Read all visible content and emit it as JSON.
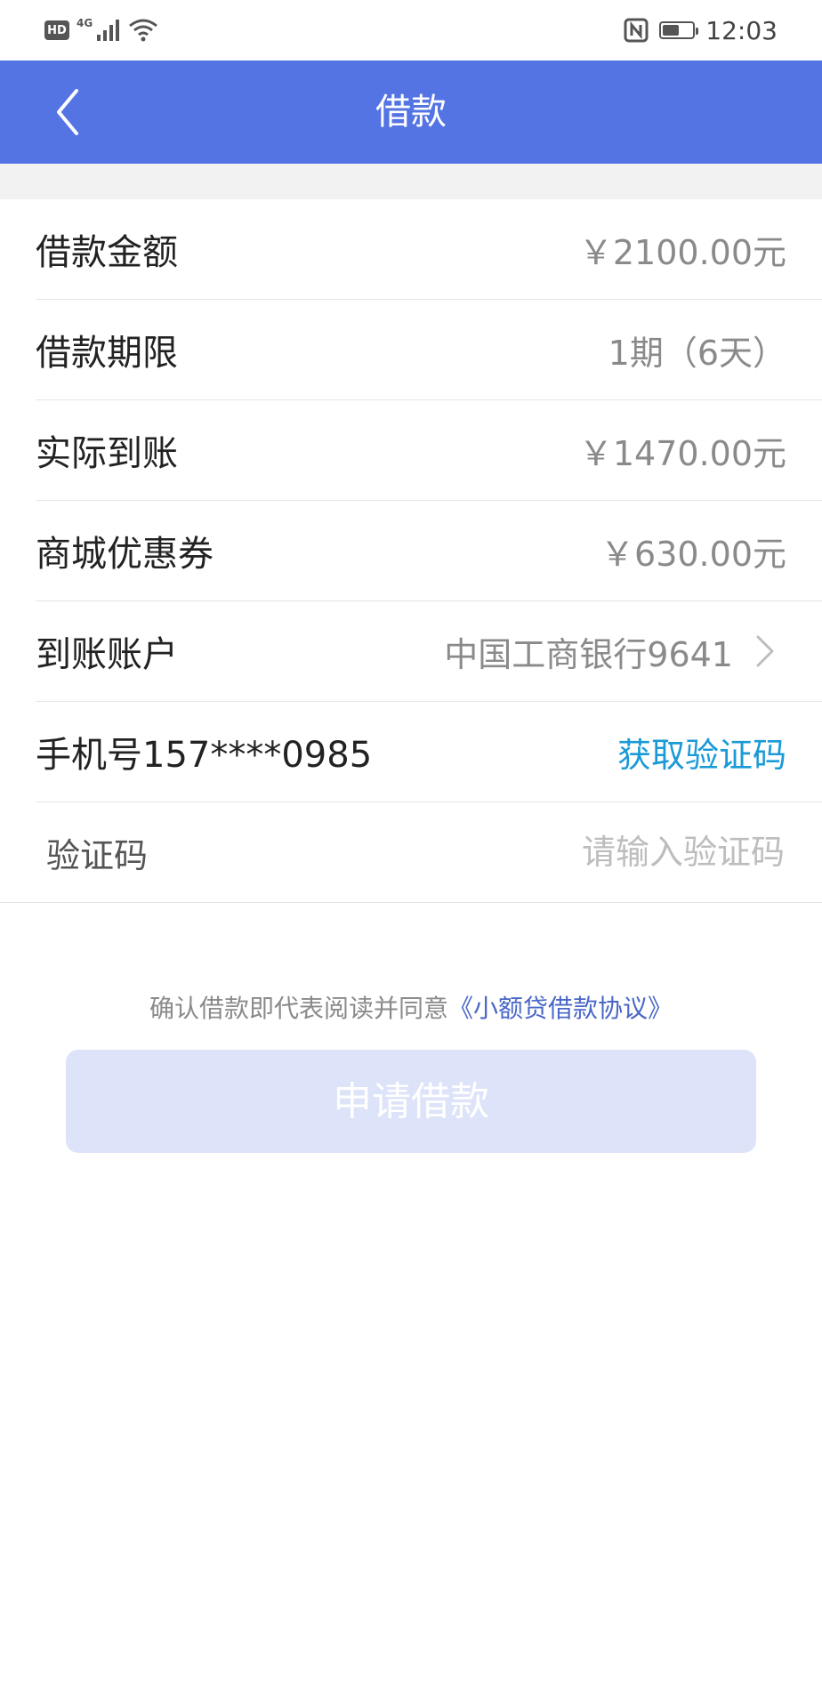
{
  "status_bar": {
    "hd": "HD",
    "network": "4G",
    "time": "12:03",
    "battery_level": 0.55,
    "icons": [
      "signal-icon",
      "wifi-icon",
      "nfc-icon",
      "battery-icon"
    ]
  },
  "nav": {
    "title": "借款",
    "back_icon": "chevron-left-icon",
    "color": "#5474e3"
  },
  "form": {
    "amount": {
      "label": "借款金额",
      "value": "￥2100.00元"
    },
    "term": {
      "label": "借款期限",
      "value": "1期（6天）"
    },
    "received": {
      "label": "实际到账",
      "value": "￥1470.00元"
    },
    "coupon": {
      "label": "商城优惠券",
      "value": "￥630.00元"
    },
    "account": {
      "label": "到账账户",
      "value": "中国工商银行9641"
    },
    "phone": {
      "label": "手机号157****0985",
      "action": "获取验证码"
    },
    "code": {
      "label": "验证码",
      "placeholder": "请输入验证码"
    }
  },
  "agreement": {
    "prefix": "确认借款即代表阅读并同意",
    "link": "《小额贷借款协议》"
  },
  "submit": {
    "label": "申请借款"
  }
}
